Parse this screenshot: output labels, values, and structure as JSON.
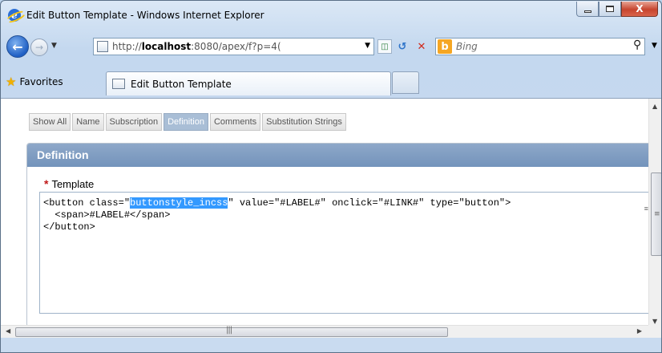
{
  "window": {
    "title": "Edit Button Template - Windows Internet Explorer",
    "close_label": "X"
  },
  "navigation": {
    "address_prefix": "http://",
    "address_host": "localhost",
    "address_rest": ":8080/apex/f?p=4(",
    "search_placeholder": "Bing"
  },
  "favorites": {
    "favorites_label": "Favorites",
    "tab_title": "Edit Button Template"
  },
  "page": {
    "tabs": [
      {
        "label": "Show All"
      },
      {
        "label": "Name"
      },
      {
        "label": "Subscription"
      },
      {
        "label": "Definition",
        "selected": true
      },
      {
        "label": "Comments"
      },
      {
        "label": "Substitution Strings"
      }
    ],
    "region_title": "Definition",
    "required_mark": "*",
    "field_label": "Template",
    "code": {
      "line1_before": "<button class=\"",
      "line1_selected": "buttonstyle_incss",
      "line1_after": "\" value=\"#LABEL#\" onclick=\"#LINK#\" type=\"button\">",
      "line2": "  <span>#LABEL#</span>",
      "line3": "</button>"
    }
  },
  "icons": {
    "ie_logo": "internet-explorer-icon",
    "back": "back-arrow-icon",
    "forward": "forward-arrow-icon",
    "refresh": "refresh-icon",
    "stop": "stop-icon",
    "search": "magnifier-icon",
    "favorites": "star-icon"
  },
  "colors": {
    "region_header": "#7f9cc3",
    "selected_tab": "#a9bed6",
    "selection_highlight": "#3399ff",
    "required_mark": "#c01818"
  }
}
